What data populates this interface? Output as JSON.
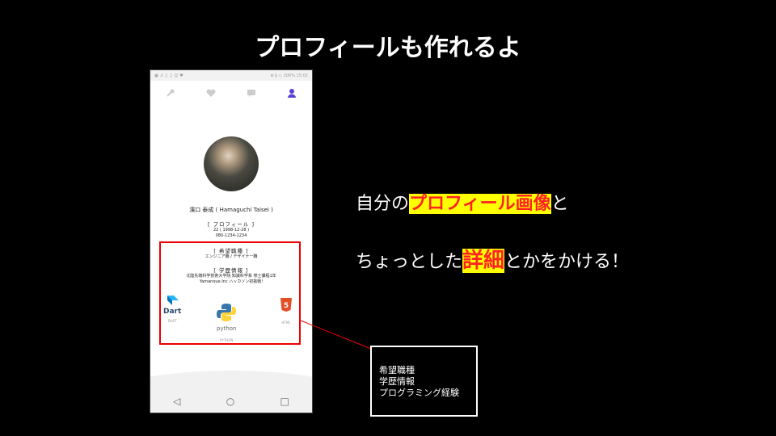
{
  "slide": {
    "title": "プロフィールも作れるよ",
    "line1": {
      "prefix": "自分の",
      "highlight": "プロフィール画像",
      "suffix": "と"
    },
    "line2": {
      "prefix": "ちょっとした",
      "highlight": "詳細",
      "suffix": "とかをかける！"
    },
    "note_lines": [
      "希望職種",
      "学歴情報",
      "プログラミング経験"
    ],
    "colors": {
      "background": "#000000",
      "highlight_bg": "#ffff00",
      "highlight_text": "#ff2222",
      "box": "#ee0000"
    }
  },
  "phone": {
    "status_left": "▣ .ıl ♫ ♫ ☺ ♥",
    "status_right": "⊕ ∦ ▭ 100% 15:02",
    "nav_icons": [
      "tool-icon",
      "heart-icon",
      "chat-icon",
      "person-icon"
    ],
    "name": "濱口 泰成 ( Hamaguchi Taisei )",
    "profile": {
      "title": "[ プロフィール ]",
      "birth": "22 ( 1998-12-28 )",
      "phone": "080-1234-1234"
    },
    "desired_job": {
      "title": "[ 希望職種 ]",
      "value": "エンジニア職 / デザイナー職"
    },
    "education": {
      "title": "[ 学歴情報 ]",
      "line1": "北陸先端科学技術大学院  知識科学系  修士課程1年",
      "line2": "Yamanoue.Inc  ハッカソン初挑戦!"
    },
    "skills": [
      {
        "name": "Dart",
        "label": "DART"
      },
      {
        "name": "python",
        "label": "PYTHON"
      },
      {
        "name": "HTML",
        "label": "HTML"
      }
    ],
    "navbar": [
      "◁",
      "○",
      "□"
    ]
  }
}
